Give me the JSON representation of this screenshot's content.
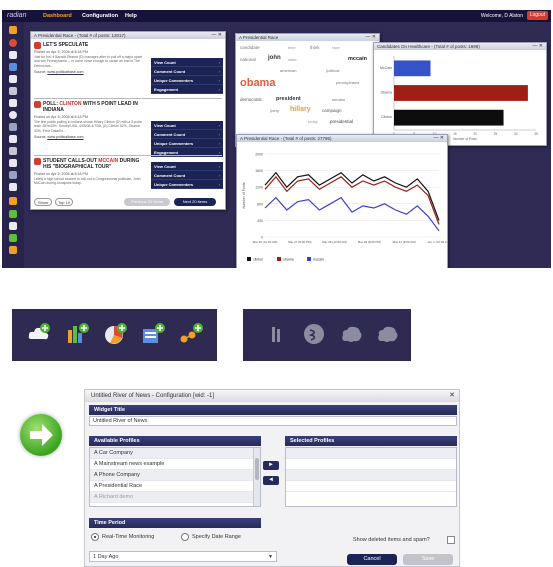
{
  "app": {
    "logo": "radian",
    "nav": [
      {
        "label": "Dashboard",
        "active": true
      },
      {
        "label": "Configuration",
        "active": false
      },
      {
        "label": "Help",
        "active": false
      }
    ],
    "welcome": "Welcome, D Alston",
    "logout": "Logout"
  },
  "news_widget": {
    "title": "A Presidential Race - (Total # of posts: 13017)",
    "items": [
      {
        "headline": "LET'S SPECULATE",
        "highlight": "",
        "posted": "Posted on Apr 5, 2008 at 8:18 PM",
        "snippet": "Just for fun: if Barack Obama (D) manages after to pull off a major upset and win Pennsylvania -- or come close enough to cause an end to The Democrats...",
        "source_label": "Source:",
        "source": "www.politicalbase.com"
      },
      {
        "headline": "POLL: CLINTON WITH 5 POINT LEAD IN INDIANA",
        "highlight": "CLINTON",
        "posted": "Posted on Apr 5, 2008 at 8:18 PM",
        "snippet": "The first public polling in Indiana shows Hillary Clinton (D) with a 5-point lead: 48%/43%. Survey/USA, 4/05/08-4/7/08, (D) Clinton 52%, Obama 43%. Error Data/Ex...",
        "source_label": "Source:",
        "source": "www.politicalbase.com"
      },
      {
        "headline": "STUDENT CALLS-OUT MCCAIN DURING HIS \"BIOGRAPHICAL TOUR\"",
        "highlight": "MCCAIN",
        "posted": "Posted on Apr 5, 2008 at 8:18 PM",
        "snippet": "Lately a high school student to call-out a Congressional politician, John McCain during Annapolis today...",
        "source_label": "Source:",
        "source": "www.politicalbase.com"
      }
    ],
    "stat_buttons": [
      "View Count",
      "Comment Count",
      "Unique Commenters",
      "Engagement"
    ],
    "pager": {
      "sort": "Show",
      "top": "Top 10",
      "prev": "Previous 20 items",
      "next": "Next 20 items"
    }
  },
  "cloud_widget": {
    "title": "A Presidential Race",
    "words": [
      {
        "text": "candidate",
        "color": "#777777"
      },
      {
        "text": "time",
        "color": "#999999"
      },
      {
        "text": "think",
        "color": "#777777"
      },
      {
        "text": "race",
        "color": "#999999"
      },
      {
        "text": "national",
        "color": "#777777"
      },
      {
        "text": "john",
        "color": "#333333"
      },
      {
        "text": "mccain",
        "color": "#222222"
      },
      {
        "text": "state",
        "color": "#999999"
      },
      {
        "text": "american",
        "color": "#777777"
      },
      {
        "text": "political",
        "color": "#777777"
      },
      {
        "text": "obama",
        "color": "#e05a3a"
      },
      {
        "text": "pennsylvania",
        "color": "#777777"
      },
      {
        "text": "democratic",
        "color": "#555555"
      },
      {
        "text": "president",
        "color": "#333333"
      },
      {
        "text": "senator",
        "color": "#777777"
      },
      {
        "text": "party",
        "color": "#777777"
      },
      {
        "text": "hillary",
        "color": "#e8a03a"
      },
      {
        "text": "campaign",
        "color": "#555555"
      },
      {
        "text": "today",
        "color": "#999999"
      },
      {
        "text": "presidential",
        "color": "#444444"
      }
    ]
  },
  "bar_widget": {
    "title": "Candidates On Healthcare - (Total # of posts: 1698)",
    "chart_data": {
      "type": "bar",
      "categories": [
        "McCain",
        "Obama",
        "Clinton"
      ],
      "values": [
        9,
        33,
        27
      ],
      "colors": [
        "#3553c8",
        "#9e1f14",
        "#0d0d0d"
      ],
      "xlim": [
        0,
        35
      ],
      "xticks": [
        "0",
        "5",
        "10",
        "15",
        "20",
        "25",
        "30",
        "35"
      ],
      "xlabel": "Number of Posts"
    }
  },
  "line_widget": {
    "title": "A Presidential Race - (Total # of posts: 27795)",
    "chart_data": {
      "type": "line",
      "ylabel": "Number of Posts",
      "ylim": [
        0,
        2000
      ],
      "yticks": [
        "0",
        "400",
        "800",
        "1200",
        "1600",
        "2000"
      ],
      "x": [
        "Mar 26",
        "Mar 27",
        "Mar 28",
        "Mar 29",
        "Mar 30",
        "Mar 31",
        "Apr 1"
      ],
      "xlabels": [
        "Mar 26 (12:00 AM)",
        "Mar 27 (8:00 PM)",
        "Mar 28 (12:00 AM)",
        "Mar 29 (8:00 PM)",
        "Mar 31 (8:00 AM)",
        "Apr 1 (12:00 AM)"
      ],
      "series": [
        {
          "name": "clinton",
          "color": "#111111",
          "values": [
            1250,
            1550,
            1200,
            1450,
            1500,
            1250,
            1400,
            1550,
            1300,
            1500,
            1350,
            1450,
            1300,
            1200,
            1400,
            1100,
            400
          ]
        },
        {
          "name": "obama",
          "color": "#9e1f14",
          "values": [
            1150,
            1450,
            1100,
            1350,
            1400,
            1150,
            1300,
            1450,
            1200,
            1350,
            1250,
            1350,
            1200,
            1100,
            1250,
            1000,
            300
          ]
        },
        {
          "name": "mccain",
          "color": "#3a3fd8",
          "values": [
            700,
            950,
            650,
            850,
            900,
            650,
            800,
            950,
            600,
            750,
            700,
            800,
            650,
            550,
            750,
            500,
            150
          ]
        }
      ]
    }
  },
  "strip1_icons": [
    "add-cloud-icon",
    "add-bar-chart-icon",
    "add-pie-chart-icon",
    "add-list-icon",
    "add-network-icon"
  ],
  "strip2_icons": [
    "bar-chart-disabled-icon",
    "pie-chart-disabled-icon",
    "cloud-disabled-icon",
    "cloud-disabled-icon"
  ],
  "config": {
    "title": "Untitled River of News - Configuration [wid: -1]",
    "widget_title_label": "Widget Title",
    "widget_title_value": "Untitled River of News",
    "available_label": "Available Profiles",
    "selected_label": "Selected Profiles",
    "available": [
      "A Car Company",
      "A Mainstream news example",
      "A Phone Company",
      "A Presidential Race",
      "A Richard demo"
    ],
    "move_right": "►",
    "move_left": "◄",
    "time_label": "Time Period",
    "radio_realtime": "Real-Time Monitoring",
    "radio_range": "Specify Date Range",
    "show_deleted": "Show deleted items and spam?",
    "period_value": "1 Day Ago",
    "cancel": "Cancel",
    "save": "Save"
  }
}
